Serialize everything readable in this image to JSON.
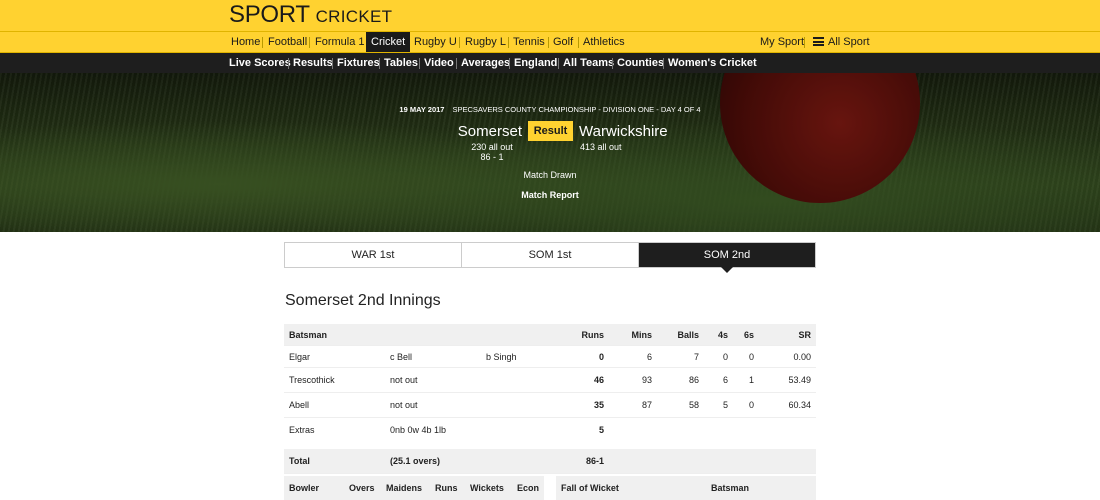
{
  "brand": {
    "sport": "SPORT",
    "section": "CRICKET"
  },
  "nav_primary": {
    "items": [
      "Home",
      "Football",
      "Formula 1",
      "Cricket",
      "Rugby U",
      "Rugby L",
      "Tennis",
      "Golf",
      "Athletics"
    ],
    "active": "Cricket",
    "my_sport": "My Sport",
    "all_sport": "All Sport"
  },
  "nav_secondary": {
    "items": [
      "Live Scores",
      "Results",
      "Fixtures",
      "Tables",
      "Video",
      "Averages",
      "England",
      "All Teams",
      "Counties",
      "Women's Cricket"
    ]
  },
  "match": {
    "date": "19 MAY 2017",
    "competition": "SPECSAVERS COUNTY CHAMPIONSHIP - DIVISION ONE - DAY 4 OF 4",
    "home_team": "Somerset",
    "away_team": "Warwickshire",
    "status_badge": "Result",
    "home_score_1": "230 all out",
    "home_score_2": "86 - 1",
    "away_score": "413 all out",
    "outcome": "Match Drawn",
    "report_link": "Match Report"
  },
  "tabs": [
    {
      "label": "WAR 1st",
      "active": false
    },
    {
      "label": "SOM 1st",
      "active": false
    },
    {
      "label": "SOM 2nd",
      "active": true
    }
  ],
  "innings": {
    "title": "Somerset 2nd Innings",
    "headers": {
      "batsman": "Batsman",
      "runs": "Runs",
      "mins": "Mins",
      "balls": "Balls",
      "fours": "4s",
      "sixes": "6s",
      "sr": "SR"
    },
    "rows": [
      {
        "name": "Elgar",
        "how": "c Bell",
        "bowler": "b Singh",
        "runs": "0",
        "mins": "6",
        "balls": "7",
        "fours": "0",
        "sixes": "0",
        "sr": "0.00"
      },
      {
        "name": "Trescothick",
        "how": "not out",
        "bowler": "",
        "runs": "46",
        "mins": "93",
        "balls": "86",
        "fours": "6",
        "sixes": "1",
        "sr": "53.49"
      },
      {
        "name": "Abell",
        "how": "not out",
        "bowler": "",
        "runs": "35",
        "mins": "87",
        "balls": "58",
        "fours": "5",
        "sixes": "0",
        "sr": "60.34"
      }
    ],
    "extras": {
      "label": "Extras",
      "detail": "0nb 0w 4b 1lb",
      "runs": "5"
    },
    "total": {
      "label": "Total",
      "detail": "(25.1 overs)",
      "runs": "86-1"
    }
  },
  "bowling": {
    "headers": {
      "bowler": "Bowler",
      "overs": "Overs",
      "maidens": "Maidens",
      "runs": "Runs",
      "wickets": "Wickets",
      "econ": "Econ"
    }
  },
  "fall_of_wicket": {
    "headers": {
      "fow": "Fall of Wicket",
      "batsman": "Batsman"
    }
  }
}
